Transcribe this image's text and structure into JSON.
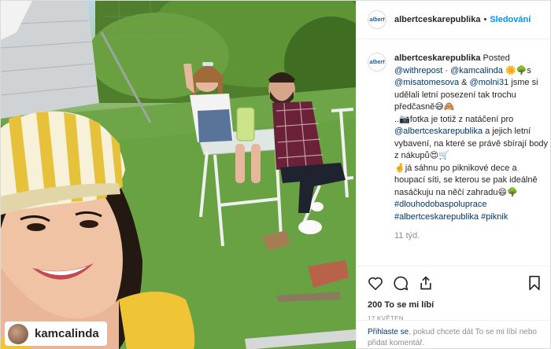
{
  "photo": {
    "tag_username": "kamcalinda"
  },
  "header": {
    "logo_text": "albert",
    "username": "albertceskarepublika",
    "separator": "•",
    "follow_label": "Sledování"
  },
  "caption": {
    "logo_text": "albert",
    "username": "albertceskarepublika",
    "posted_word": "Posted",
    "mention_withrepost": "@withrepost",
    "mention_kamcalinda": "@kamcalinda",
    "after_kamcalinda": " 🌼🌳s",
    "mention_misatomesova": "@misatomesova",
    "amp": " & ",
    "mention_molni31": "@molni31",
    "text_1": " jsme si udělali letní posezení tak trochu předčasně😅🙈",
    "text_2": "..📷fotka je totiž z natáčení pro ",
    "mention_albert": "@albertceskarepublika",
    "text_3": " a jejich letní vybavení, na které se právě sbírají body z nákupů😍🛒",
    "text_4": "🤞já sáhnu po piknikové dece a houpací síti, se kterou se pak ideálně nasáčkuju na něčí zahradu😄🌳",
    "hashtag_1": "#dlouhodobaspoluprace",
    "hashtag_2": "#albertceskarepublika",
    "hashtag_3": "#piknik",
    "time": "11 týd."
  },
  "actions": {
    "likes": "200 To se mi líbí",
    "date": "17 KVĚTEN"
  },
  "login": {
    "link": "Přihlaste se",
    "text": ", pokud chcete dát To se mi líbí nebo přidat komentář."
  }
}
